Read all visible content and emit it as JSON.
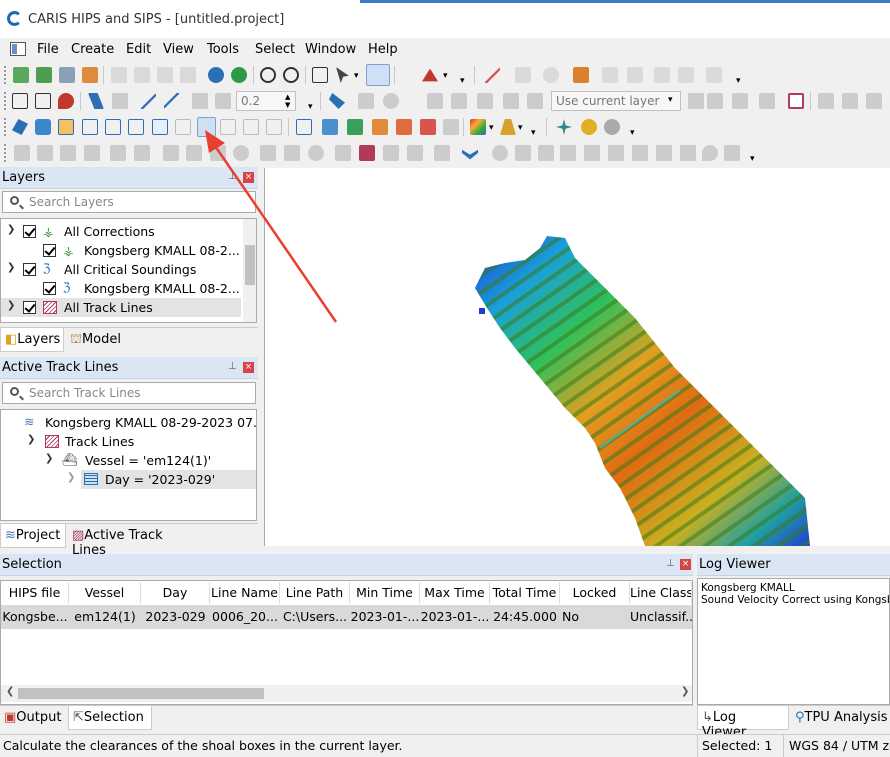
{
  "app": {
    "title": "CARIS HIPS and SIPS - [untitled.project]"
  },
  "menu": [
    "File",
    "Create",
    "Edit",
    "View",
    "Tools",
    "Select",
    "Window",
    "Help"
  ],
  "toolbar": {
    "zoom_value": "0.2",
    "layer_select": "Use current layer",
    "label_3d": "3D"
  },
  "layers_panel": {
    "title": "Layers",
    "search_placeholder": "Search Layers",
    "rows": [
      {
        "label": "All Corrections"
      },
      {
        "label": "Kongsberg KMALL 08-2..."
      },
      {
        "label": "All Critical Soundings"
      },
      {
        "label": "Kongsberg KMALL 08-2..."
      },
      {
        "label": "All Track Lines"
      }
    ],
    "tabs": [
      "Layers",
      "Model"
    ]
  },
  "track_panel": {
    "title": "Active Track Lines",
    "search_placeholder": "Search Track Lines",
    "rows": [
      {
        "label": "Kongsberg KMALL 08-29-2023 07..."
      },
      {
        "label": "Track Lines"
      },
      {
        "label": "Vessel = 'em124(1)'"
      },
      {
        "label": "Day = '2023-029'"
      }
    ],
    "tabs": [
      "Project",
      "Active Track Lines"
    ]
  },
  "selection_panel": {
    "title": "Selection",
    "columns": [
      "HIPS file",
      "Vessel",
      "Day",
      "Line Name",
      "Line Path",
      "Min Time",
      "Max Time",
      "Total Time",
      "Locked",
      "Line Class"
    ],
    "row": [
      "Kongsbe...",
      "em124(1)",
      "2023-029",
      "0006_20...",
      "C:\\Users...",
      "2023-01-...",
      "2023-01-...",
      "24:45.000",
      "No",
      "Unclassif..."
    ],
    "tabs": [
      "Output",
      "Selection"
    ]
  },
  "log_panel": {
    "title": "Log Viewer",
    "lines": [
      "Kongsberg KMALL",
      "Sound Velocity Correct using Kongsberg"
    ],
    "tabs": [
      "Log Viewer",
      "TPU Analysis"
    ]
  },
  "status": {
    "message": "Calculate the clearances of the shoal boxes in the current layer.",
    "selected": "Selected: 1",
    "crs": "WGS 84 / UTM zo"
  },
  "colors": {
    "panel_header": "#dbe6f4",
    "accent": "#1a6ab8",
    "close": "#d64545",
    "annotation_arrow": "#e8402e"
  }
}
